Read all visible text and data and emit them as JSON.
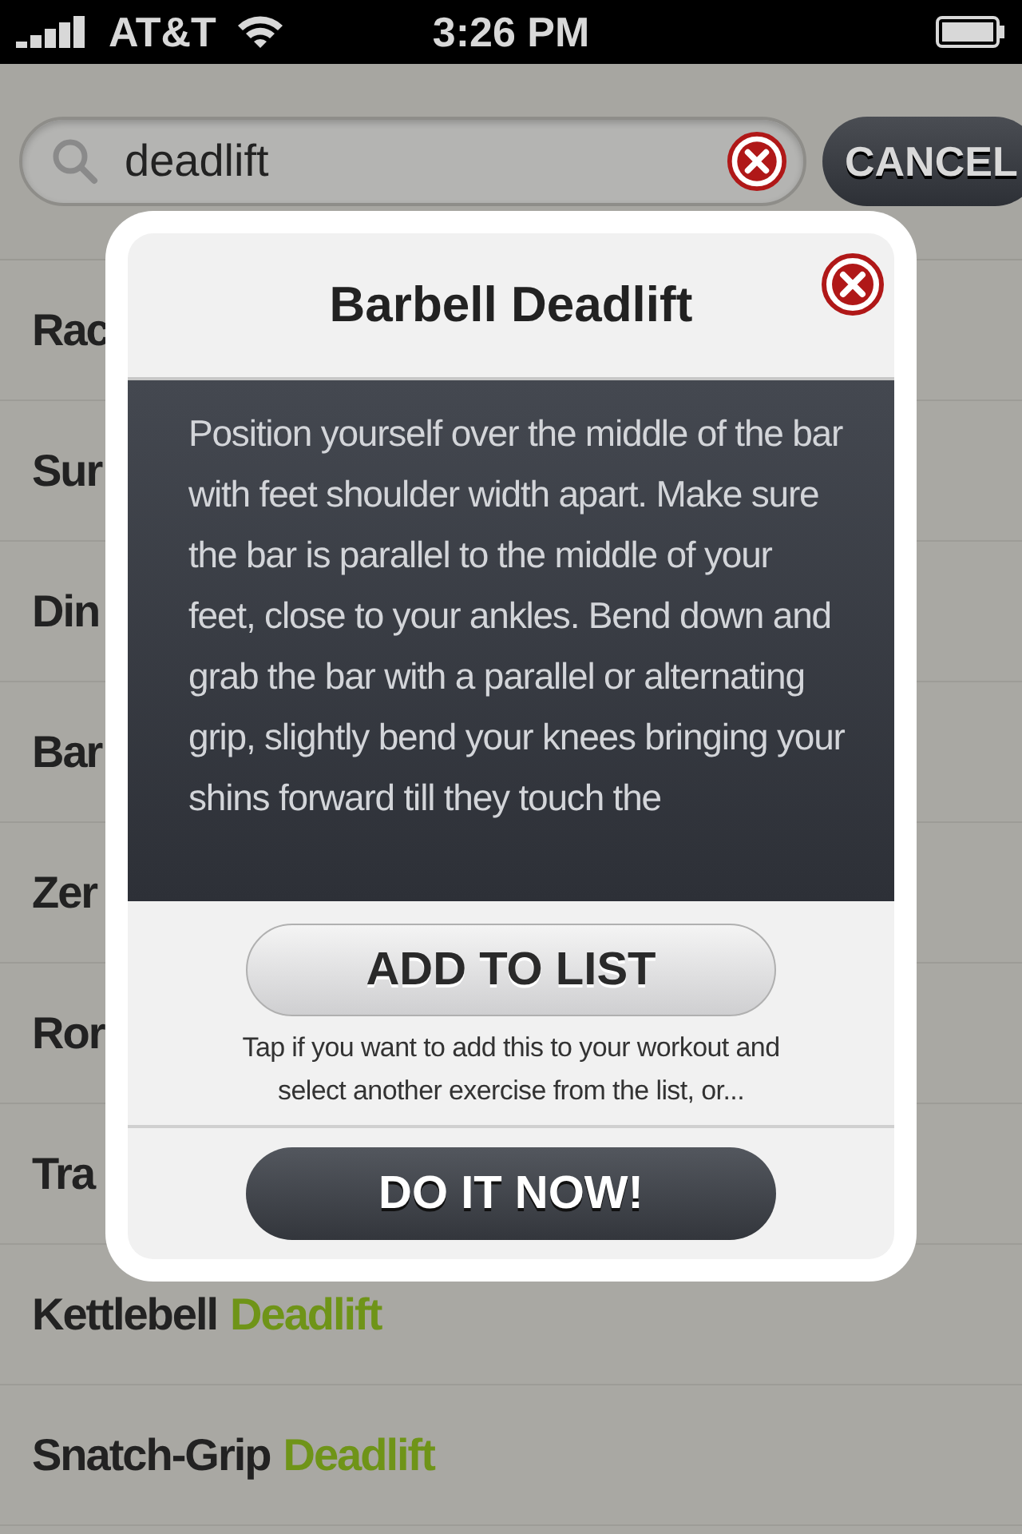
{
  "status_bar": {
    "carrier": "AT&T",
    "time": "3:26 PM"
  },
  "search": {
    "value": "deadlift",
    "cancel": "CANCEL"
  },
  "results": [
    {
      "text": "Rac"
    },
    {
      "text": "Sur"
    },
    {
      "text": "Din"
    },
    {
      "text": "Bar"
    },
    {
      "text": "Zer"
    },
    {
      "text": "Ror"
    },
    {
      "text": "Tra"
    },
    {
      "text": "Kettlebell",
      "match": "Deadlift"
    },
    {
      "text": "Snatch-Grip",
      "match": "Deadlift"
    }
  ],
  "dialog": {
    "title": "Barbell Deadlift",
    "description": "Position yourself over the middle of the bar with feet shoulder width apart. Make sure the bar is parallel to the middle of your feet, close to your ankles. Bend down and grab the bar with a parallel or alternating grip, slightly bend your knees bringing your shins forward till they touch the",
    "add_button": "ADD TO LIST",
    "hint": "Tap if you want to add this to your workout and select another exercise from the list, or...",
    "do_button": "DO IT NOW!"
  }
}
